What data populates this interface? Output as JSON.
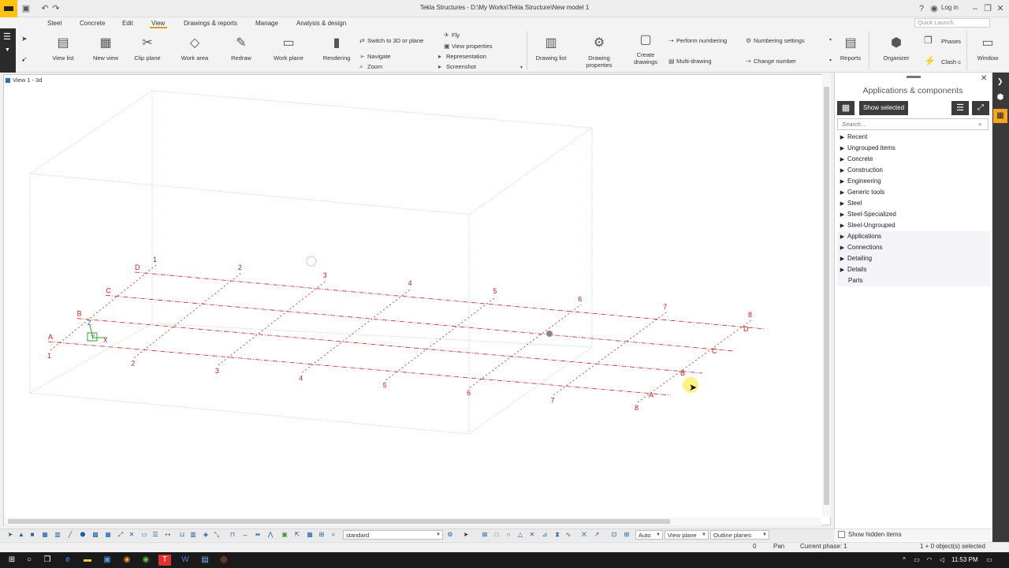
{
  "window": {
    "title": "Tekla Structures - D:\\My Works\\Tekla Structure\\New model 1",
    "login": "Log in",
    "quick_launch_placeholder": "Quick Launch"
  },
  "menu": [
    "Steel",
    "Concrete",
    "Edit",
    "View",
    "Drawings & reports",
    "Manage",
    "Analysis & design"
  ],
  "ribbon": {
    "view_list": "View list",
    "new_view": "New view",
    "clip_plane": "Clip plane",
    "work_area": "Work area",
    "redraw": "Redraw",
    "work_plane": "Work plane",
    "rendering": "Rendering",
    "switch_3d": "Switch to 3D or plane",
    "navigate": "Navigate",
    "zoom": "Zoom",
    "fly": "Fly",
    "view_properties": "View properties",
    "representation": "Representation",
    "screenshot": "Screenshot",
    "drawing_list": "Drawing list",
    "drawing_properties_1": "Drawing",
    "drawing_properties_2": "properties",
    "create_drawings_1": "Create",
    "create_drawings_2": "drawings",
    "perform_numbering": "Perform numbering",
    "multi_drawing": "Multi-drawing",
    "numbering_settings": "Numbering settings",
    "change_number": "Change number",
    "reports": "Reports",
    "organizer": "Organizer",
    "phases": "Phases",
    "clash": "Clash c",
    "window": "Window"
  },
  "view": {
    "title": "View 1 - 3d"
  },
  "grid": {
    "number_labels": [
      "1",
      "2",
      "3",
      "4",
      "5",
      "6",
      "7",
      "8"
    ],
    "letter_labels": [
      "A",
      "B",
      "C",
      "D"
    ],
    "axis_labels": {
      "z": "Z",
      "y": "Y",
      "x": "X"
    }
  },
  "side_panel": {
    "title": "Applications & components",
    "show_selected": "Show selected",
    "search_placeholder": "Search...",
    "categories": [
      "Recent",
      "Ungrouped items",
      "Concrete",
      "Construction",
      "Engineering",
      "Generic tools",
      "Steel",
      "Steel-Specialized",
      "Steel-Ungrouped",
      "Applications",
      "Connections",
      "Detailing",
      "Details"
    ],
    "parts": "Parts",
    "show_hidden": "Show hidden items"
  },
  "bottom_toolbar": {
    "standard": "standard",
    "auto": "Auto",
    "view_plane": "View plane",
    "outline_planes": "Outline planes"
  },
  "status": {
    "zero": "0",
    "pan": "Pan",
    "phase": "Current phase: 1",
    "selected": "1 + 0 object(s) selected"
  },
  "taskbar": {
    "time": "11:53 PM"
  },
  "colors": {
    "grid": "#c81e1e",
    "accent": "#ffc20e",
    "side_dark": "#3c3c3c"
  }
}
